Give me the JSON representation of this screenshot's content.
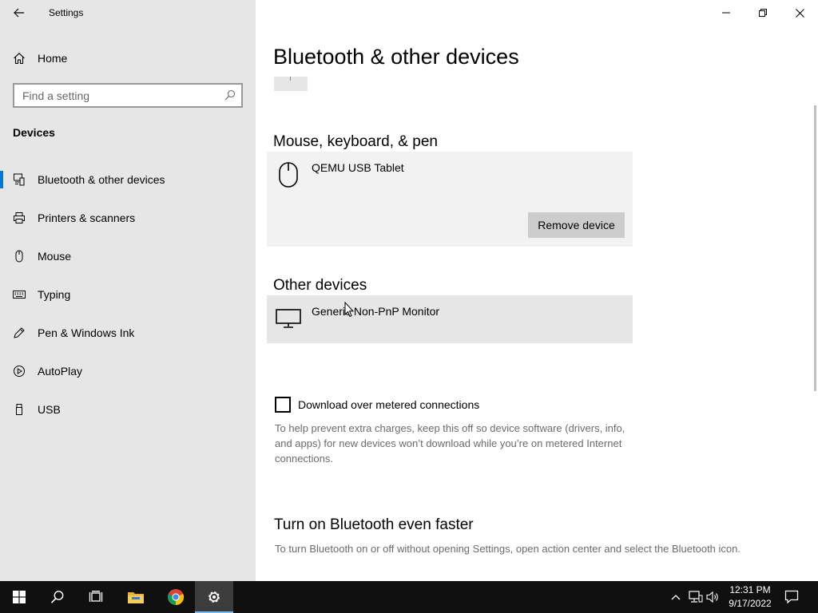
{
  "window": {
    "app_title": "Settings",
    "controls": {
      "minimize": "minimize-icon",
      "restore": "restore-icon",
      "close": "close-icon"
    }
  },
  "sidebar": {
    "home_label": "Home",
    "search_placeholder": "Find a setting",
    "section_label": "Devices",
    "items": [
      {
        "label": "Bluetooth & other devices",
        "icon": "bluetooth-devices-icon",
        "active": true
      },
      {
        "label": "Printers & scanners",
        "icon": "printer-icon",
        "active": false
      },
      {
        "label": "Mouse",
        "icon": "mouse-icon",
        "active": false
      },
      {
        "label": "Typing",
        "icon": "keyboard-icon",
        "active": false
      },
      {
        "label": "Pen & Windows Ink",
        "icon": "pen-icon",
        "active": false
      },
      {
        "label": "AutoPlay",
        "icon": "autoplay-icon",
        "active": false
      },
      {
        "label": "USB",
        "icon": "usb-icon",
        "active": false
      }
    ]
  },
  "main": {
    "page_title": "Bluetooth & other devices",
    "mouse_section": {
      "heading": "Mouse, keyboard, & pen",
      "device_name": "QEMU USB Tablet",
      "remove_label": "Remove device"
    },
    "other_section": {
      "heading": "Other devices",
      "device_name": "Generic Non-PnP Monitor"
    },
    "metered": {
      "label": "Download over metered connections",
      "checked": false,
      "help": "To help prevent extra charges, keep this off so device software (drivers, info, and apps) for new devices won’t download while you’re on metered Internet connections."
    },
    "faster": {
      "title": "Turn on Bluetooth even faster",
      "desc": "To turn Bluetooth on or off without opening Settings, open action center and select the Bluetooth icon."
    }
  },
  "taskbar": {
    "clock_time": "12:31 PM",
    "clock_date": "9/17/2022",
    "accent": "#76b9ed"
  },
  "colors": {
    "accent": "#0078d7",
    "sidebar_bg": "#e6e6e6",
    "taskbar_bg": "#101010"
  }
}
